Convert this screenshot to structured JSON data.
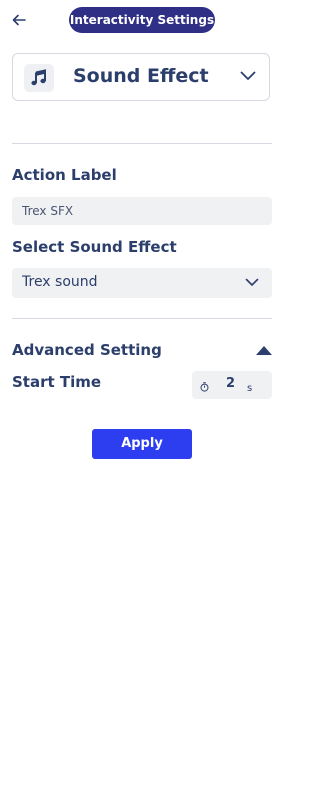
{
  "header": {
    "title": "Interactivity Settings",
    "back_icon": "arrow-left-icon"
  },
  "type_select": {
    "icon": "music-note-icon",
    "value": "Sound Effect"
  },
  "action_label": {
    "label": "Action Label",
    "value": "Trex SFX"
  },
  "sound_effect": {
    "label": "Select Sound Effect",
    "value": "Trex sound"
  },
  "advanced": {
    "label": "Advanced Setting",
    "expanded": true,
    "start_time": {
      "label": "Start Time",
      "value": "2",
      "unit": "s",
      "icon": "timer-icon"
    }
  },
  "apply_label": "Apply",
  "colors": {
    "accent_pill": "#2f2f85",
    "primary_button": "#2c3ef0",
    "text": "#2c3e6b",
    "field_bg": "#f0f1f3",
    "divider": "#d6d9e2"
  }
}
